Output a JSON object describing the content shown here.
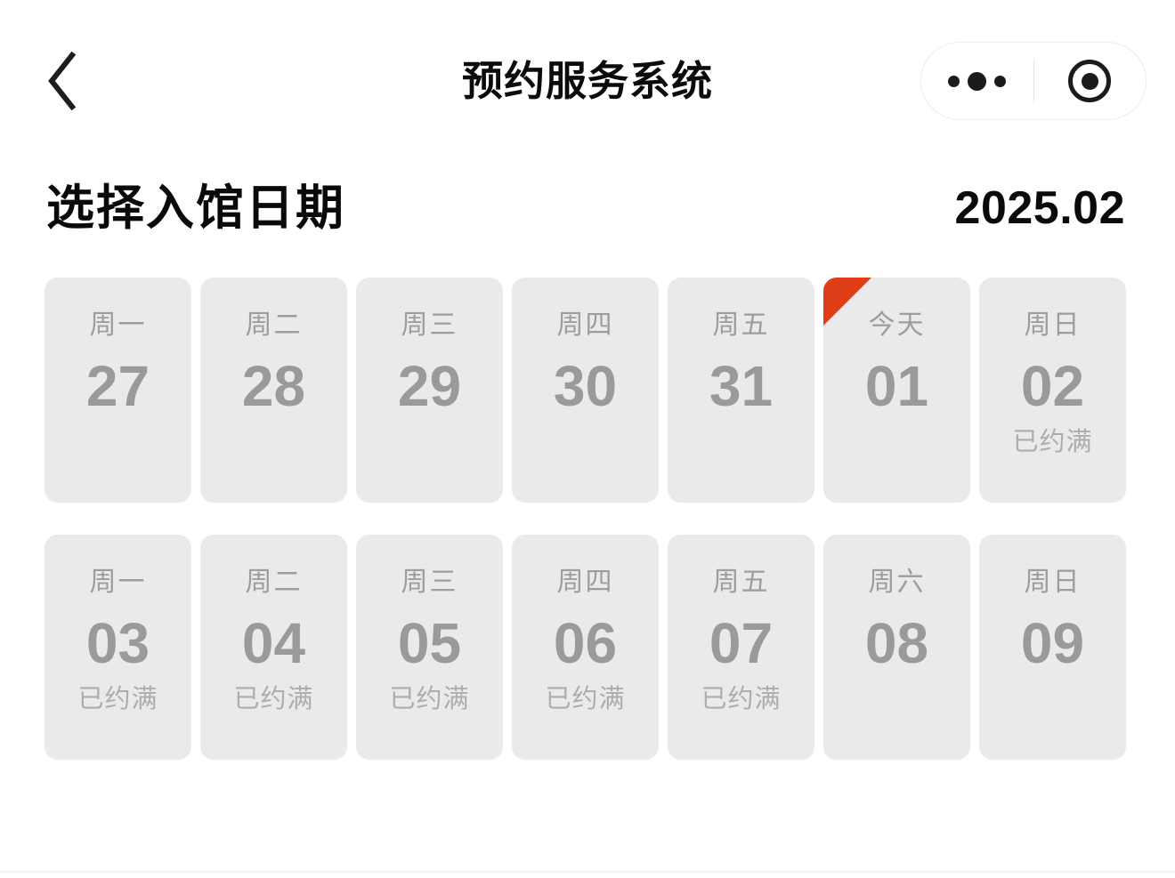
{
  "navbar": {
    "back_icon": "chevron-left-icon",
    "title": "预约服务系统",
    "more_icon": "more-dots-icon",
    "target_icon": "target-circle-icon"
  },
  "section": {
    "title": "选择入馆日期",
    "month": "2025.02"
  },
  "colors": {
    "today_marker": "#df3c18",
    "card_bg": "#eaeaea",
    "day_number": "#9a9a9a",
    "weekday_label": "#9d9d9d",
    "status_text": "#adadad",
    "page_bg": "#ffffff",
    "heading": "#0a0a0a"
  },
  "calendar": {
    "rows": [
      {
        "cells": [
          {
            "weekday": "周一",
            "day": "27",
            "status": "",
            "is_today": false
          },
          {
            "weekday": "周二",
            "day": "28",
            "status": "",
            "is_today": false
          },
          {
            "weekday": "周三",
            "day": "29",
            "status": "",
            "is_today": false
          },
          {
            "weekday": "周四",
            "day": "30",
            "status": "",
            "is_today": false
          },
          {
            "weekday": "周五",
            "day": "31",
            "status": "",
            "is_today": false
          },
          {
            "weekday": "今天",
            "day": "01",
            "status": "",
            "is_today": true
          },
          {
            "weekday": "周日",
            "day": "02",
            "status": "已约满",
            "is_today": false
          }
        ]
      },
      {
        "cells": [
          {
            "weekday": "周一",
            "day": "03",
            "status": "已约满",
            "is_today": false
          },
          {
            "weekday": "周二",
            "day": "04",
            "status": "已约满",
            "is_today": false
          },
          {
            "weekday": "周三",
            "day": "05",
            "status": "已约满",
            "is_today": false
          },
          {
            "weekday": "周四",
            "day": "06",
            "status": "已约满",
            "is_today": false
          },
          {
            "weekday": "周五",
            "day": "07",
            "status": "已约满",
            "is_today": false
          },
          {
            "weekday": "周六",
            "day": "08",
            "status": "",
            "is_today": false
          },
          {
            "weekday": "周日",
            "day": "09",
            "status": "",
            "is_today": false
          }
        ]
      }
    ]
  }
}
